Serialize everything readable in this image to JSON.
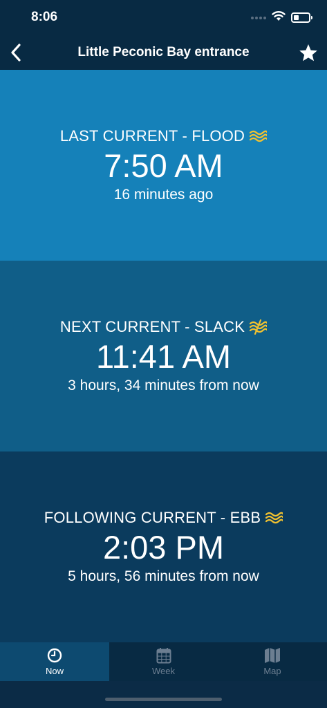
{
  "status": {
    "time": "8:06"
  },
  "nav": {
    "title": "Little Peconic Bay entrance"
  },
  "panels": [
    {
      "label": "LAST CURRENT - FLOOD",
      "time": "7:50 AM",
      "relative": "16 minutes ago",
      "icon": "flood-wave-icon"
    },
    {
      "label": "NEXT CURRENT - SLACK",
      "time": "11:41 AM",
      "relative": "3 hours, 34 minutes from now",
      "icon": "slack-wave-icon"
    },
    {
      "label": "FOLLOWING CURRENT - EBB",
      "time": "2:03 PM",
      "relative": "5 hours, 56 minutes from now",
      "icon": "ebb-wave-icon"
    }
  ],
  "tabs": [
    {
      "label": "Now",
      "icon": "clock-icon",
      "active": true
    },
    {
      "label": "Week",
      "icon": "calendar-icon",
      "active": false
    },
    {
      "label": "Map",
      "icon": "map-icon",
      "active": false
    }
  ],
  "colors": {
    "header": "#082a43",
    "panel1": "#1581b9",
    "panel2": "#105e88",
    "panel3": "#0b3b5d",
    "accent_yellow": "#f2c230",
    "tab_active": "#0d4a70"
  }
}
